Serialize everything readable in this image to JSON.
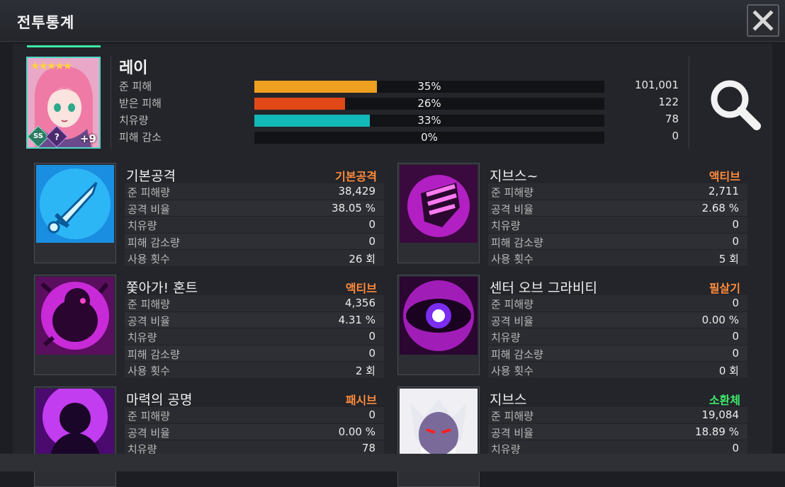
{
  "window": {
    "title": "전투통계",
    "close_icon": "close-icon"
  },
  "hero": {
    "name": "레이",
    "stars": "★★★★★",
    "grade": "SS",
    "grade2": "?",
    "level_bonus": "+9",
    "stats": [
      {
        "label": "준 피해",
        "percent_text": "35%",
        "fraction": 0.35,
        "value": "101,001",
        "color": "#f0a020"
      },
      {
        "label": "받은 피해",
        "percent_text": "26%",
        "fraction": 0.26,
        "value": "122",
        "color": "#e04818"
      },
      {
        "label": "치유량",
        "percent_text": "33%",
        "fraction": 0.33,
        "value": "78",
        "color": "#12b8b8"
      },
      {
        "label": "피해 감소",
        "percent_text": "0%",
        "fraction": 0.0,
        "value": "0",
        "color": "#888888"
      }
    ]
  },
  "skills": [
    {
      "name": "기본공격",
      "type": "기본공격",
      "type_color": "#ff8a3c",
      "icon": "sword-icon",
      "rows": [
        [
          "준 피해량",
          "38,429"
        ],
        [
          "공격 비율",
          "38.05 %"
        ],
        [
          "치유량",
          "0"
        ],
        [
          "피해 감소량",
          "0"
        ],
        [
          "사용 횟수",
          "26 회"
        ]
      ]
    },
    {
      "name": "지브스~",
      "type": "액티브",
      "type_color": "#ff8a3c",
      "icon": "fist-icon",
      "rows": [
        [
          "준 피해량",
          "2,711"
        ],
        [
          "공격 비율",
          "2.68 %"
        ],
        [
          "치유량",
          "0"
        ],
        [
          "피해 감소량",
          "0"
        ],
        [
          "사용 횟수",
          "5 회"
        ]
      ]
    },
    {
      "name": "쫓아가! 혼트",
      "type": "액티브",
      "type_color": "#ff8a3c",
      "icon": "ghost-icon",
      "rows": [
        [
          "준 피해량",
          "4,356"
        ],
        [
          "공격 비율",
          "4.31 %"
        ],
        [
          "치유량",
          "0"
        ],
        [
          "피해 감소량",
          "0"
        ],
        [
          "사용 횟수",
          "2 회"
        ]
      ]
    },
    {
      "name": "센터 오브 그라비티",
      "type": "필살기",
      "type_color": "#ff8a3c",
      "icon": "eye-icon",
      "rows": [
        [
          "준 피해량",
          "0"
        ],
        [
          "공격 비율",
          "0.00 %"
        ],
        [
          "치유량",
          "0"
        ],
        [
          "피해 감소량",
          "0"
        ],
        [
          "사용 횟수",
          "0 회"
        ]
      ]
    },
    {
      "name": "마력의 공명",
      "type": "패시브",
      "type_color": "#ff8a3c",
      "icon": "silhouette-icon",
      "rows": [
        [
          "준 피해량",
          "0"
        ],
        [
          "공격 비율",
          "0.00 %"
        ],
        [
          "치유량",
          "78"
        ]
      ]
    },
    {
      "name": "지브스",
      "type": "소환체",
      "type_color": "#3ee86a",
      "icon": "demon-icon",
      "rows": [
        [
          "준 피해량",
          "19,084"
        ],
        [
          "공격 비율",
          "18.89 %"
        ],
        [
          "치유량",
          "0"
        ]
      ]
    }
  ]
}
